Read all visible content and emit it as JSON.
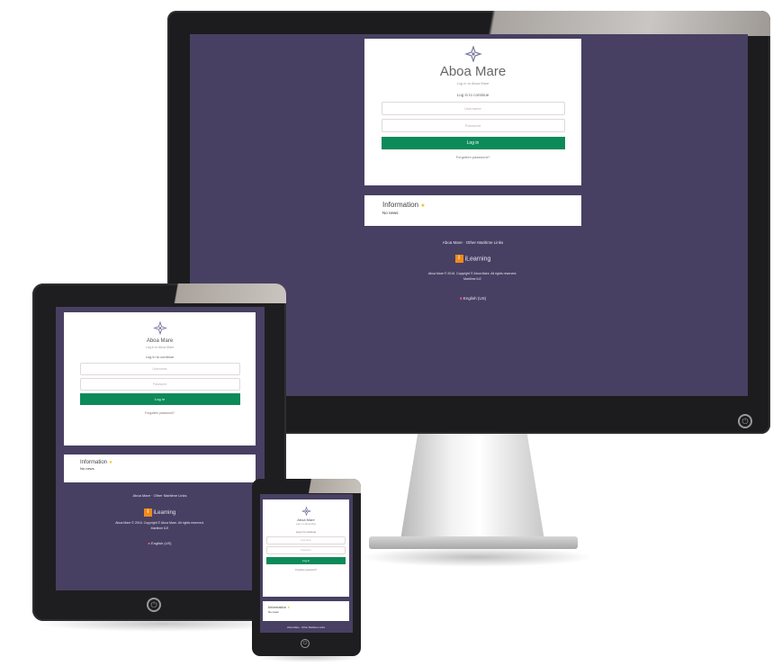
{
  "site": {
    "title": "Aboa Mare",
    "subtitle": "Log in to Aboa Mare",
    "login_heading": "Log in to continue",
    "username_placeholder": "Username",
    "password_placeholder": "Password",
    "login_button": "Log in",
    "forgot_link": "Forgotten password?",
    "info_title": "Information",
    "info_body": "No news",
    "footer_links": "Aboa Mare · Other Maritime Links",
    "ilearn_label": "iLearning",
    "copyright": "Aboa Mare © 2016. Copyright © Aboa Mare. All rights reserved.",
    "copyright_line2": "Maritime ILE",
    "language": "English (US)"
  },
  "icons": {
    "logo": "compass-star-icon",
    "star": "star-icon",
    "power": "power-icon",
    "flag": "flag-icon"
  },
  "colors": {
    "screen_bg": "#484062",
    "button": "#0d8a5a",
    "ilearn": "#f08a1c",
    "info_star": "#e8c21a"
  }
}
